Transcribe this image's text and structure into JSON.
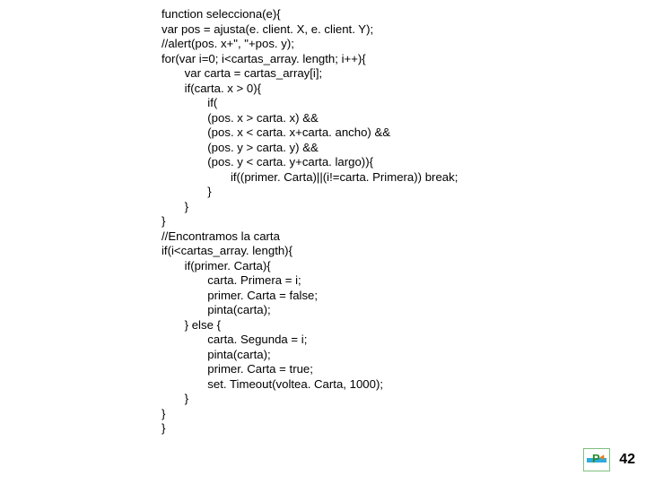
{
  "code": {
    "l1": "function selecciona(e){",
    "l2": "var pos = ajusta(e. client. X, e. client. Y);",
    "l3": "//alert(pos. x+\", \"+pos. y);",
    "l4": "for(var i=0; i<cartas_array. length; i++){",
    "l5": "       var carta = cartas_array[i];",
    "l6": "       if(carta. x > 0){",
    "l7": "              if(",
    "l8": "              (pos. x > carta. x) &&",
    "l9": "              (pos. x < carta. x+carta. ancho) &&",
    "l10": "              (pos. y > carta. y) &&",
    "l11": "              (pos. y < carta. y+carta. largo)){",
    "l12": "                     if((primer. Carta)||(i!=carta. Primera)) break;",
    "l13": "              }",
    "l14": "       }",
    "l15": "}",
    "l16": "//Encontramos la carta",
    "l17": "if(i<cartas_array. length){",
    "l18": "       if(primer. Carta){",
    "l19": "              carta. Primera = i;",
    "l20": "              primer. Carta = false;",
    "l21": "              pinta(carta);",
    "l22": "       } else {",
    "l23": "              carta. Segunda = i;",
    "l24": "              pinta(carta);",
    "l25": "              primer. Carta = true;",
    "l26": "              set. Timeout(voltea. Carta, 1000);",
    "l27": "       }",
    "l28": "}",
    "l29": "}"
  },
  "page_number": "42"
}
